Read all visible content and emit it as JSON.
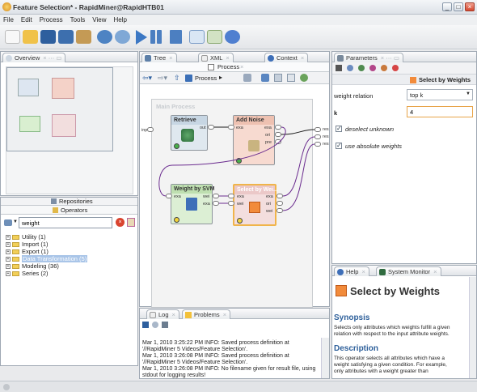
{
  "window": {
    "title": "Feature Selection* - RapidMiner@RapidHTB01"
  },
  "menu": [
    "File",
    "Edit",
    "Process",
    "Tools",
    "View",
    "Help"
  ],
  "overview": {
    "tab": "Overview"
  },
  "repositories": {
    "tab": "Repositories"
  },
  "operators": {
    "tab": "Operators",
    "search_value": "weight",
    "tree": [
      "Utility (1)",
      "Import (1)",
      "Export (1)",
      "Data Transformation (5)",
      "Modeling (36)",
      "Series (2)"
    ]
  },
  "center_tabs": {
    "tree": "Tree",
    "xml": "XML",
    "context": "Context",
    "process": "Process"
  },
  "process": {
    "breadcrumb": "Process",
    "canvas_title": "Main Process",
    "ports": {
      "inp": "inp",
      "res": "res"
    },
    "operators": {
      "retrieve": {
        "name": "Retrieve",
        "out": "out"
      },
      "add_noise": {
        "name": "Add Noise",
        "exa": "exa",
        "ori": "ori",
        "pre": "pre"
      },
      "weight_svm": {
        "name": "Weight by SVM",
        "exa": "exa",
        "wei": "wei"
      },
      "select_weights": {
        "name": "Select by Wei...",
        "exa": "exa",
        "wei": "wei",
        "ori": "ori"
      }
    }
  },
  "log": {
    "tab_log": "Log",
    "tab_problems": "Problems",
    "lines": [
      "Mar 1, 2010 3:25:22 PM INFO: Saved process definition at",
      "'//RapidMiner 5 Videos/Feature Selection'.",
      "Mar 1, 2010 3:26:08 PM INFO: Saved process definition at",
      "'//RapidMiner 5 Videos/Feature Selection'.",
      "Mar 1, 2010 3:26:08 PM INFO: No filename given for result file, using",
      "stdout for logging results!"
    ]
  },
  "parameters": {
    "tab": "Parameters",
    "operator": "Select by Weights",
    "weight_relation_label": "weight relation",
    "weight_relation_value": "top k",
    "k_label": "k",
    "k_value": "4",
    "deselect_unknown": "deselect unknown",
    "use_absolute_weights": "use absolute weights"
  },
  "help": {
    "tab_help": "Help",
    "tab_monitor": "System Monitor",
    "title": "Select by Weights",
    "synopsis_heading": "Synopsis",
    "synopsis_text_1": "Selects only attributes which weights fulfill a given",
    "synopsis_text_2": "relation with respect to the input attribute weights.",
    "description_heading": "Description",
    "description_text_1": "This operator selects all attributes which have a",
    "description_text_2": "weight satisfying a given condition. For example,",
    "description_text_3": "only attributes with a weight greater than"
  }
}
